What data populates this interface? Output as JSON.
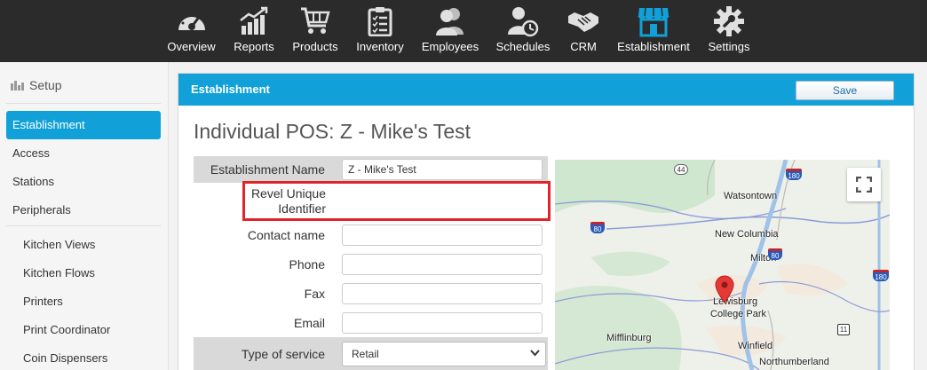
{
  "nav": {
    "items": [
      {
        "label": "Overview",
        "icon": "speedometer-icon"
      },
      {
        "label": "Reports",
        "icon": "bar-chart-icon"
      },
      {
        "label": "Products",
        "icon": "shopping-cart-icon"
      },
      {
        "label": "Inventory",
        "icon": "clipboard-icon"
      },
      {
        "label": "Employees",
        "icon": "people-icon"
      },
      {
        "label": "Schedules",
        "icon": "person-clock-icon"
      },
      {
        "label": "CRM",
        "icon": "handshake-icon"
      },
      {
        "label": "Establishment",
        "icon": "storefront-icon"
      },
      {
        "label": "Settings",
        "icon": "gear-icon"
      }
    ],
    "active_color": "#11a1d8"
  },
  "sidebar": {
    "heading": "Setup",
    "items": [
      {
        "label": "Establishment"
      },
      {
        "label": "Access"
      },
      {
        "label": "Stations"
      },
      {
        "label": "Peripherals"
      },
      {
        "label": "Kitchen Views"
      },
      {
        "label": "Kitchen Flows"
      },
      {
        "label": "Printers"
      },
      {
        "label": "Print Coordinator"
      },
      {
        "label": "Coin Dispensers"
      }
    ]
  },
  "panel": {
    "title": "Establishment",
    "save_label": "Save",
    "page_title": "Individual POS: Z - Mike's Test"
  },
  "form": {
    "establishment_name_label": "Establishment Name",
    "establishment_name_value": "Z - Mike's Test",
    "revel_uid_label": "Revel Unique Identifier",
    "contact_name_label": "Contact name",
    "phone_label": "Phone",
    "fax_label": "Fax",
    "email_label": "Email",
    "type_of_service_label": "Type of service",
    "type_of_service_value": "Retail"
  },
  "map": {
    "labels": {
      "watsontown": "Watsontown",
      "new_columbia": "New Columbia",
      "milton": "Milton",
      "lewisburg": "Lewisburg",
      "college_park": "College Park",
      "mifflinburg": "Mifflinburg",
      "winfield": "Winfield",
      "northumberland": "Northumberland"
    },
    "shields": {
      "r44": "44",
      "i180a": "180",
      "i80a": "80",
      "i80b": "80",
      "i180b": "180",
      "r11": "11"
    }
  }
}
